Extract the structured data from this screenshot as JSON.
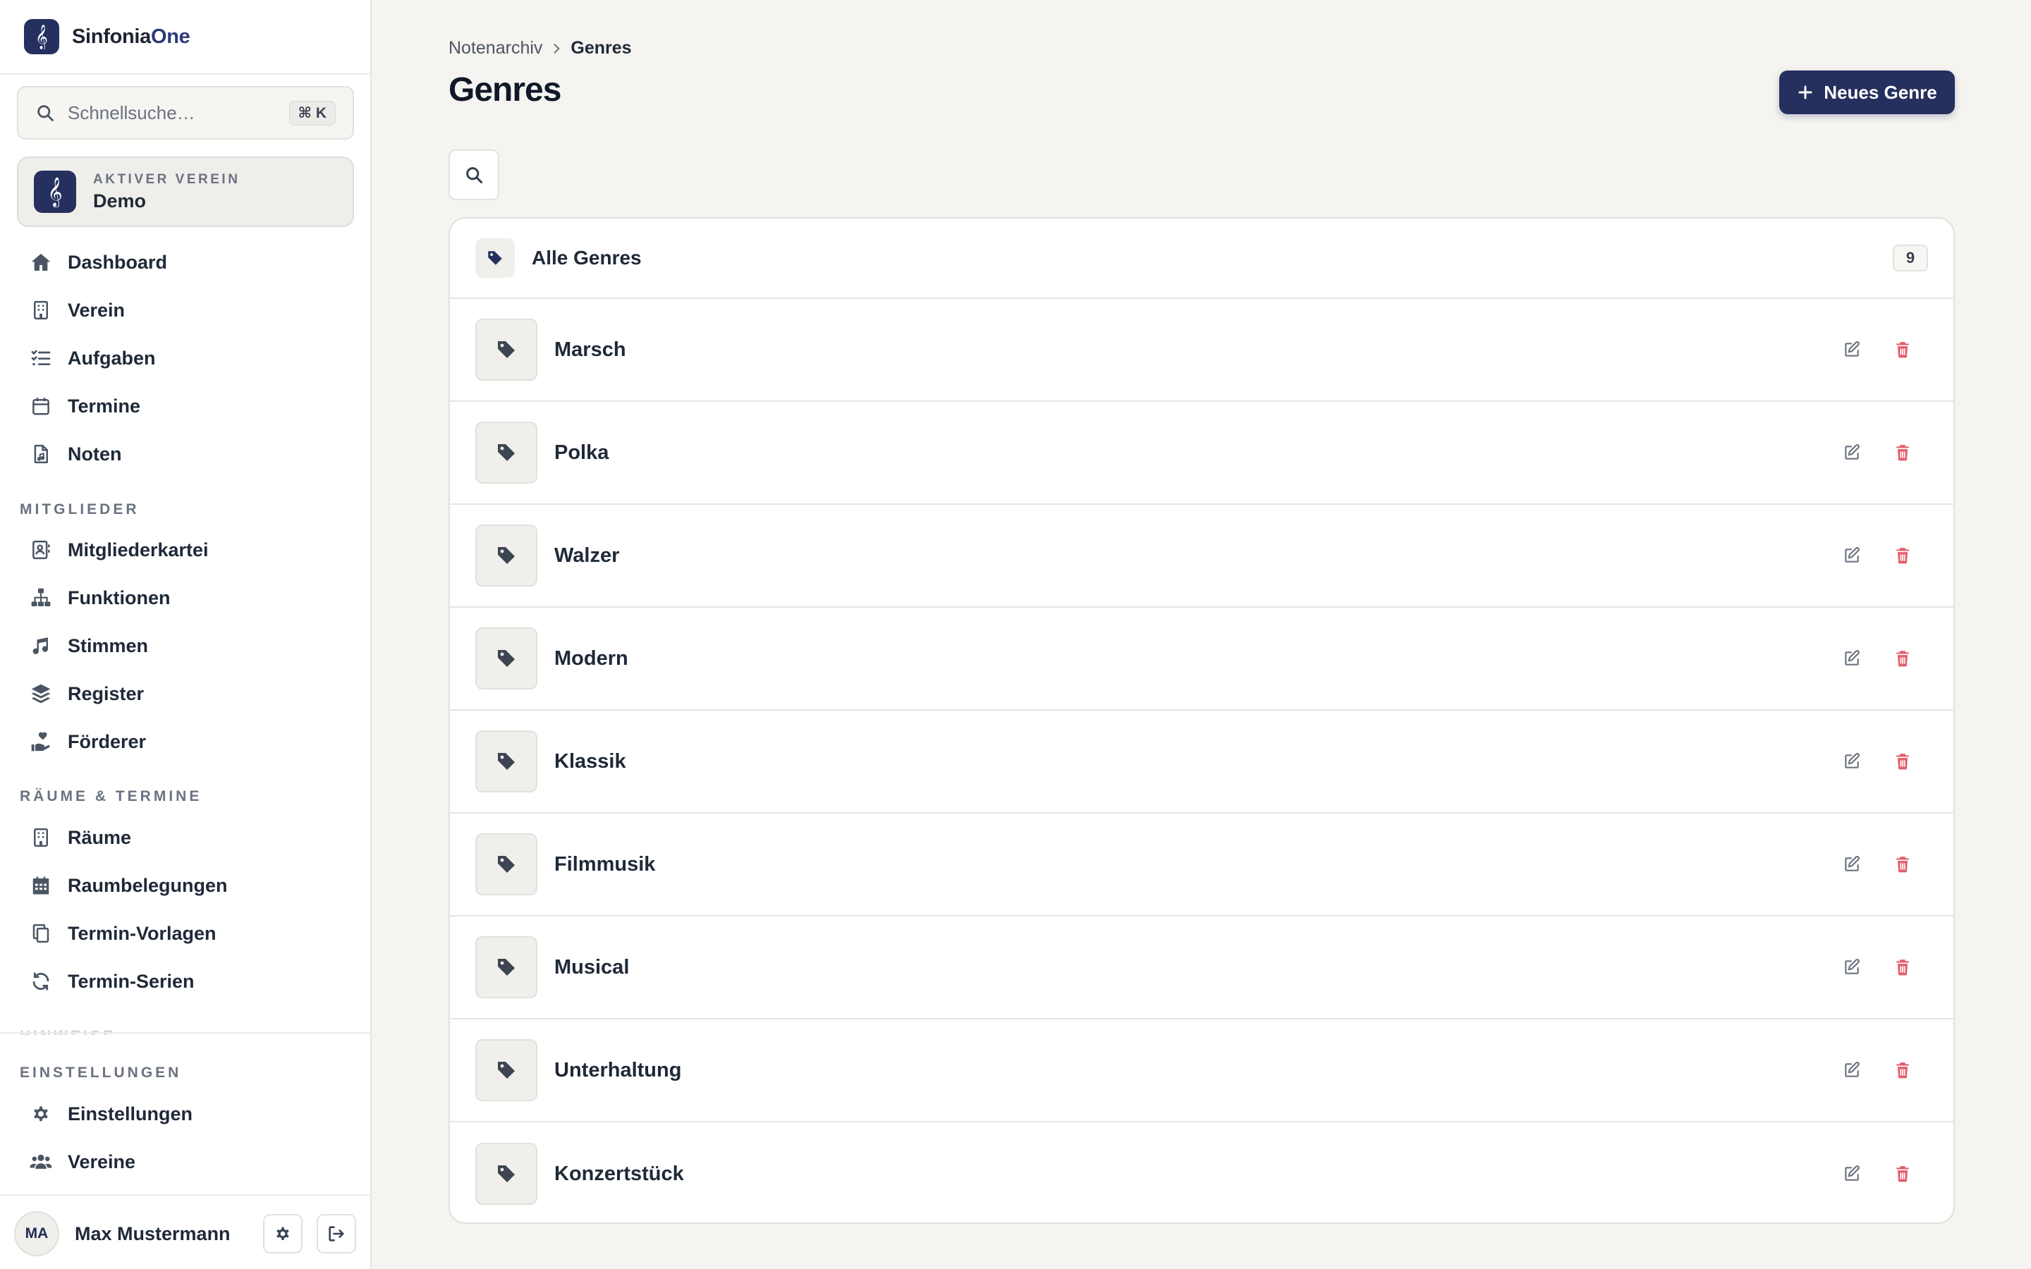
{
  "brand": {
    "name_main": "Sinfonia",
    "name_accent": "One"
  },
  "search": {
    "placeholder": "Schnellsuche…",
    "shortcut": "⌘ K"
  },
  "club": {
    "label": "AKTIVER VEREIN",
    "name": "Demo"
  },
  "nav": {
    "main": [
      {
        "label": "Dashboard",
        "icon": "home-icon"
      },
      {
        "label": "Verein",
        "icon": "building-icon"
      },
      {
        "label": "Aufgaben",
        "icon": "tasks-icon"
      },
      {
        "label": "Termine",
        "icon": "calendar-icon"
      },
      {
        "label": "Noten",
        "icon": "sheet-music-file-icon"
      }
    ],
    "mitglieder_label": "MITGLIEDER",
    "mitglieder": [
      {
        "label": "Mitgliederkartei",
        "icon": "contact-card-icon"
      },
      {
        "label": "Funktionen",
        "icon": "sitemap-icon"
      },
      {
        "label": "Stimmen",
        "icon": "music-note-icon"
      },
      {
        "label": "Register",
        "icon": "layers-icon"
      },
      {
        "label": "Förderer",
        "icon": "hand-holding-heart-icon"
      }
    ],
    "raeume_label": "RÄUME & TERMINE",
    "raeume": [
      {
        "label": "Räume",
        "icon": "building-icon"
      },
      {
        "label": "Raumbelegungen",
        "icon": "calendar-grid-icon"
      },
      {
        "label": "Termin-Vorlagen",
        "icon": "copy-icon"
      },
      {
        "label": "Termin-Serien",
        "icon": "refresh-icon"
      }
    ],
    "einstellungen_label": "EINSTELLUNGEN",
    "einstellungen": [
      {
        "label": "Einstellungen",
        "icon": "gear-icon"
      },
      {
        "label": "Vereine",
        "icon": "users-icon"
      }
    ]
  },
  "user": {
    "initials": "MA",
    "name": "Max Mustermann"
  },
  "breadcrumb": {
    "parent": "Notenarchiv",
    "current": "Genres"
  },
  "page": {
    "title": "Genres",
    "new_button": "Neues Genre"
  },
  "list": {
    "header_label": "Alle Genres",
    "count": "9",
    "genres": [
      "Marsch",
      "Polka",
      "Walzer",
      "Modern",
      "Klassik",
      "Filmmusik",
      "Musical",
      "Unterhaltung",
      "Konzertstück"
    ]
  },
  "colors": {
    "primary": "#25305e",
    "delete": "#e35d6a",
    "background": "#f5f4f1"
  }
}
